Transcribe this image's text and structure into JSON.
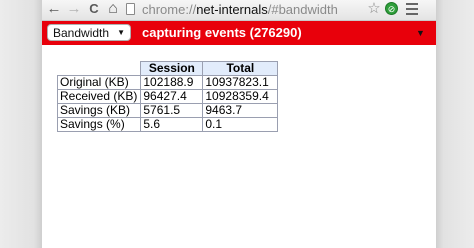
{
  "browser": {
    "nav": {
      "back_icon": "back-arrow-icon",
      "back_glyph": "←",
      "forward_icon": "forward-arrow-icon",
      "forward_glyph": "→",
      "reload_icon": "reload-icon",
      "reload_glyph": "C",
      "home_icon": "home-icon",
      "home_glyph": "⌂"
    },
    "url": {
      "scheme": "chrome://",
      "host": "net-internals",
      "path": "/#bandwidth"
    },
    "star_glyph": "☆",
    "extension_glyph": "⊘"
  },
  "status_bar": {
    "view_select": {
      "selected": "Bandwidth",
      "arrow": "▼"
    },
    "text": "capturing events (276290)",
    "menu_arrow": "▼",
    "background_color": "#e8000b"
  },
  "bandwidth_table": {
    "columns": [
      "Session",
      "Total"
    ],
    "rows": [
      {
        "label": "Original (KB)",
        "session": "102188.9",
        "total": "10937823.1"
      },
      {
        "label": "Received (KB)",
        "session": "96427.4",
        "total": "10928359.4"
      },
      {
        "label": "Savings (KB)",
        "session": "5761.5",
        "total": "9463.7"
      },
      {
        "label": "Savings (%)",
        "session": "5.6",
        "total": "0.1"
      }
    ],
    "header_color": "#e2ecfb"
  }
}
